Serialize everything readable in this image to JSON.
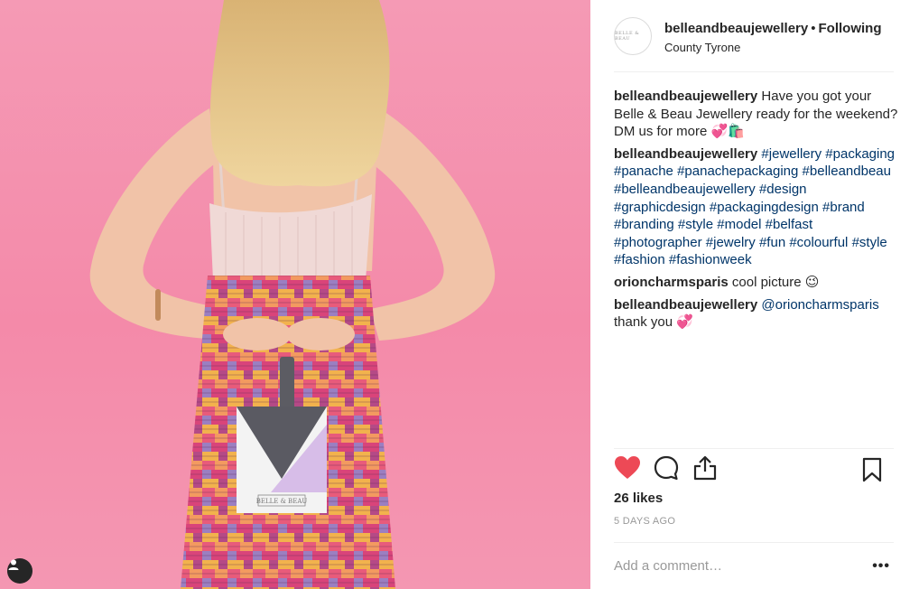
{
  "brand_colors": {
    "heart": "#ed4956",
    "hashtag": "#003569",
    "muted": "#999999",
    "background_pink": "#f48aa9"
  },
  "photo": {
    "bag_label": "BELLE & BEAU",
    "tag_user_icon": "user-icon"
  },
  "header": {
    "avatar_text": "BELLE & BEAU",
    "username": "belleandbeaujewellery",
    "separator": "•",
    "follow_status": "Following",
    "location": "County Tyrone"
  },
  "comments": [
    {
      "user": "belleandbeaujewellery",
      "text": "Have you got your Belle & Beau Jewellery ready for the weekend? DM us for more 💞🛍️"
    },
    {
      "user": "belleandbeaujewellery",
      "hashtags": [
        "#jewellery",
        "#packaging",
        "#panache",
        "#panachepackaging",
        "#belleandbeau",
        "#belleandbeaujewellery",
        "#design",
        "#graphicdesign",
        "#packagingdesign",
        "#brand",
        "#branding",
        "#style",
        "#model",
        "#belfast",
        "#photographer",
        "#jewelry",
        "#fun",
        "#colourful",
        "#style",
        "#fashion",
        "#fashionweek"
      ]
    },
    {
      "user": "orioncharmsparis",
      "text": "cool picture 😉"
    },
    {
      "user": "belleandbeaujewellery",
      "mention": "@orioncharmsparis",
      "text": "thank you 💞"
    }
  ],
  "actions": {
    "like_icon": "heart-icon",
    "comment_icon": "comment-icon",
    "share_icon": "share-icon",
    "save_icon": "bookmark-icon"
  },
  "likes": "26 likes",
  "time_ago": "5 DAYS AGO",
  "comment_input": {
    "placeholder": "Add a comment…",
    "value": ""
  },
  "more_label": "•••"
}
